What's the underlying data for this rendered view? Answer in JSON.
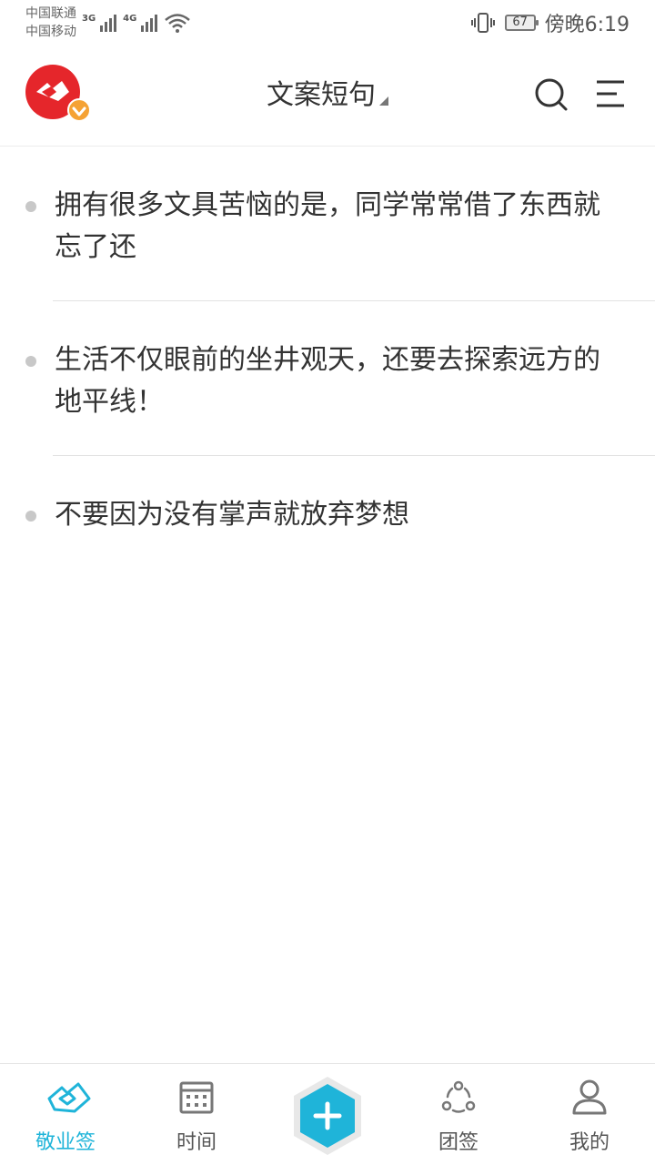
{
  "status_bar": {
    "carrier1": "中国联通",
    "carrier2": "中国移动",
    "net1": "3G",
    "net2": "4G",
    "battery": "67",
    "time": "傍晚6:19"
  },
  "header": {
    "title": "文案短句"
  },
  "quotes": [
    {
      "text": "拥有很多文具苦恼的是，同学常常借了东西就忘了还"
    },
    {
      "text": "生活不仅眼前的坐井观天，还要去探索远方的地平线！"
    },
    {
      "text": "不要因为没有掌声就放弃梦想"
    }
  ],
  "bottom_nav": {
    "items": [
      {
        "label": "敬业签",
        "icon": "jingyeqian-icon",
        "active": true
      },
      {
        "label": "时间",
        "icon": "calendar-icon",
        "active": false
      },
      {
        "label": "",
        "icon": "add-icon",
        "active": false
      },
      {
        "label": "团签",
        "icon": "team-icon",
        "active": false
      },
      {
        "label": "我的",
        "icon": "person-icon",
        "active": false
      }
    ]
  },
  "colors": {
    "accent": "#1fb4d9",
    "logo_red": "#e5262b",
    "badge_orange": "#f5a234",
    "text": "#333333"
  }
}
